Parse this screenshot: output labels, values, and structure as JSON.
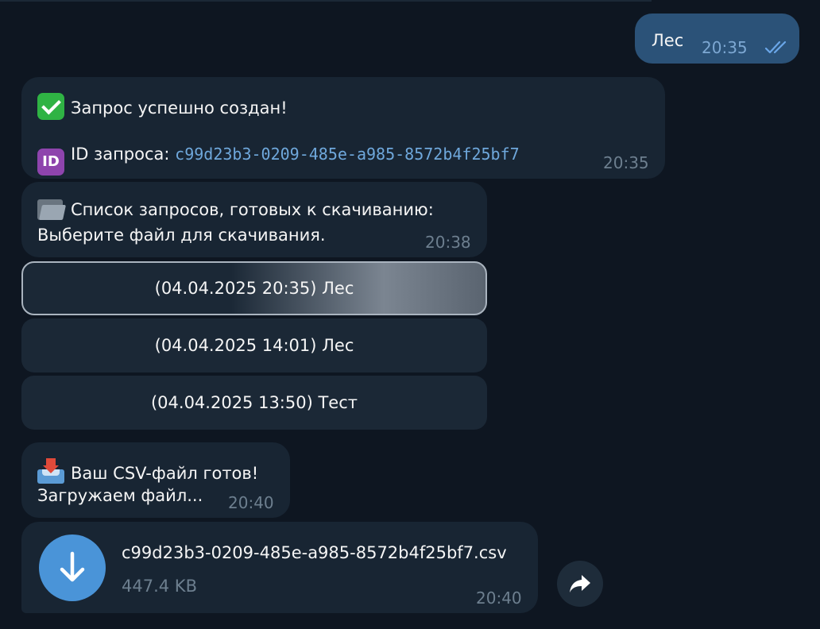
{
  "outgoing": {
    "text": "Лес",
    "time": "20:35",
    "status": "read"
  },
  "msg_created": {
    "title": "Запрос успешно создан!",
    "id_badge": "ID",
    "id_label": "ID запроса:",
    "id_value": "c99d23b3-0209-485e-a985-8572b4f25bf7",
    "time": "20:35"
  },
  "msg_list": {
    "title": "Список запросов, готовых к скачиванию:",
    "subtitle": "Выберите файл для скачивания.",
    "time": "20:38"
  },
  "keyboard": [
    {
      "label": "(04.04.2025 20:35) Лес"
    },
    {
      "label": "(04.04.2025 14:01) Лес"
    },
    {
      "label": "(04.04.2025 13:50) Тест"
    }
  ],
  "msg_ready": {
    "title": "Ваш CSV-файл готов!",
    "subtitle": "Загружаем файл...",
    "time": "20:40"
  },
  "file_msg": {
    "filename": "c99d23b3-0209-485e-a985-8572b4f25bf7.csv",
    "size": "447.4 KB",
    "time": "20:40"
  },
  "colors": {
    "background": "#0e1621",
    "incoming": "#182533",
    "outgoing": "#2b5278",
    "accent": "#4a94d8",
    "link": "#6fa8dc"
  },
  "icons": {
    "created": "check-mark-button-icon",
    "id": "id-button-icon",
    "list": "open-folder-icon",
    "ready": "inbox-tray-icon",
    "download": "download-arrow-icon",
    "forward": "forward-arrow-icon",
    "read_status": "double-check-icon"
  }
}
